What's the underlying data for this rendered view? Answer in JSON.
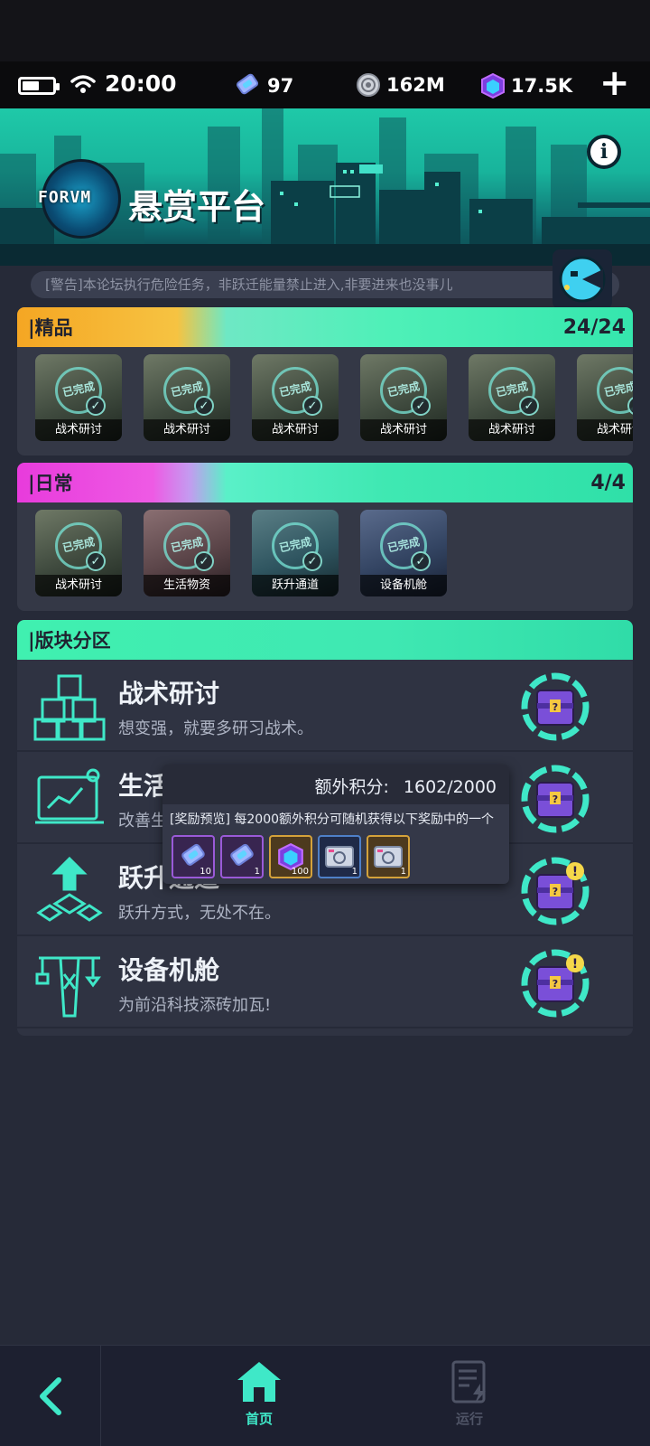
{
  "status_bar": {
    "time": "20:00",
    "resources": [
      {
        "icon": "ticket-icon",
        "value": "97"
      },
      {
        "icon": "coin-icon",
        "value": "162M"
      },
      {
        "icon": "cube-icon",
        "value": "17.5K"
      }
    ],
    "add_label": "+"
  },
  "header": {
    "logo_text": "FORVM",
    "title": "悬赏平台"
  },
  "notice": "[警告]本论坛执行危险任务，非跃迁能量禁止进入,非要进来也没事儿",
  "sections": {
    "premium": {
      "title": "|精品",
      "count": "24/24",
      "cards": [
        {
          "label": "战术研讨"
        },
        {
          "label": "战术研讨"
        },
        {
          "label": "战术研讨"
        },
        {
          "label": "战术研讨"
        },
        {
          "label": "战术研讨"
        },
        {
          "label": "战术研讨"
        }
      ]
    },
    "daily": {
      "title": "|日常",
      "count": "4/4",
      "cards": [
        {
          "label": "战术研讨"
        },
        {
          "label": "生活物资"
        },
        {
          "label": "跃升通道"
        },
        {
          "label": "设备机舱"
        }
      ]
    },
    "board": {
      "title": "|版块分区",
      "rows": [
        {
          "title": "战术研讨",
          "subtitle": "想变强，就要多研习战术。"
        },
        {
          "title": "生活物资",
          "subtitle": "改善生活"
        },
        {
          "title": "跃升通道",
          "subtitle": "跃升方式，无处不在。"
        },
        {
          "title": "设备机舱",
          "subtitle": "为前沿科技添砖加瓦!"
        }
      ]
    }
  },
  "card_done_text": "已完成",
  "tooltip": {
    "points_label": "额外积分:",
    "points_value": "1602/2000",
    "description": "[奖励预览] 每2000额外积分可随机获得以下奖励中的一个",
    "rewards": [
      {
        "icon": "ticket-icon",
        "qty": "10"
      },
      {
        "icon": "ticket-icon",
        "qty": "1"
      },
      {
        "icon": "cube-icon",
        "qty": "100"
      },
      {
        "icon": "camera-card-icon",
        "qty": "1"
      },
      {
        "icon": "camera-card-icon",
        "qty": "1"
      }
    ]
  },
  "bottom_nav": {
    "home_label": "首页",
    "run_label": "运行"
  },
  "colors": {
    "accent_teal": "#3fe8b2",
    "premium_gold": "#f5a623",
    "daily_pink": "#e83bdc",
    "background": "#262a38"
  }
}
